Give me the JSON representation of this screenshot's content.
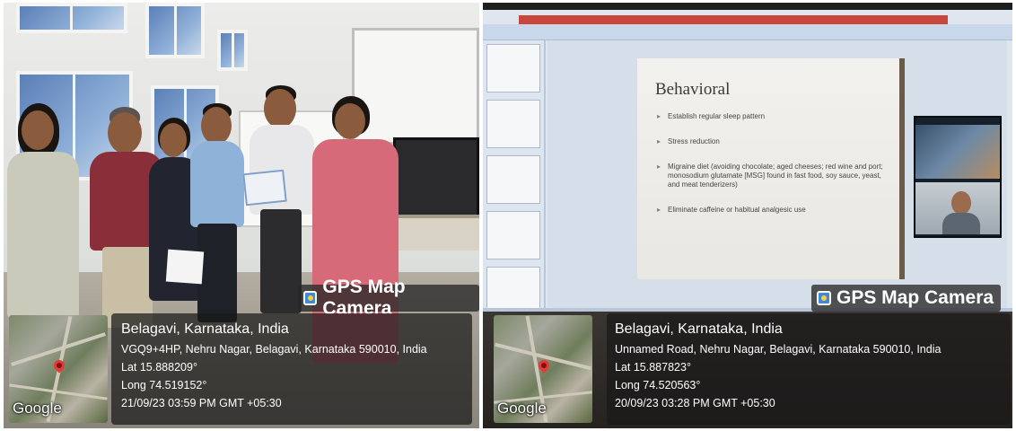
{
  "left_photo": {
    "badge": "GPS Map Camera",
    "location": "Belagavi, Karnataka, India",
    "address": "VGQ9+4HP, Nehru Nagar, Belagavi, Karnataka 590010, India",
    "lat": "Lat 15.888209°",
    "long": "Long 74.519152°",
    "datetime": "21/09/23 03:59 PM GMT +05:30",
    "map_label": "Google"
  },
  "right_photo": {
    "badge": "GPS Map Camera",
    "location": "Belagavi, Karnataka, India",
    "address": "Unnamed Road, Nehru Nagar, Belagavi, Karnataka 590010, India",
    "lat": "Lat 15.887823°",
    "long": "Long 74.520563°",
    "datetime": "20/09/23 03:28 PM GMT +05:30",
    "map_label": "Google",
    "slide": {
      "title": "Behavioral",
      "bullets": [
        "Establish regular sleep pattern",
        "Stress reduction",
        "Migraine diet (avoiding chocolate; aged cheeses; red wine and port; monosodium glutamate [MSG] found in fast food, soy sauce, yeast, and meat tenderizers)",
        "Eliminate caffeine or habitual analgesic use"
      ]
    }
  },
  "icons": {
    "camera": "gps-camera-icon",
    "map_pin": "map-pin-icon"
  },
  "colors": {
    "overlay": "#191919",
    "badge_icon": "#3d8bd7",
    "map_pin": "#e53935"
  }
}
